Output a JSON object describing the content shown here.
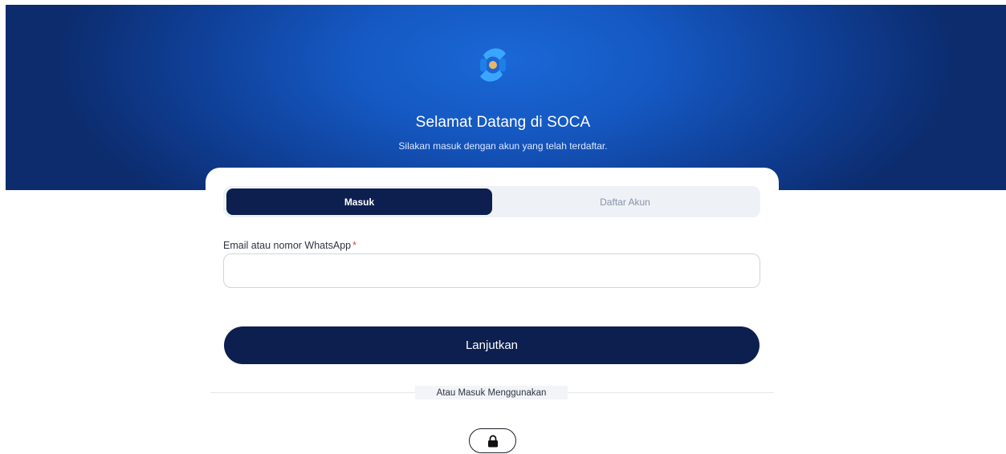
{
  "header": {
    "logo_icon": "soca-logo-icon",
    "title": "Selamat Datang di SOCA",
    "subtitle": "Silakan masuk dengan akun yang telah terdaftar."
  },
  "tabs": [
    {
      "label": "Masuk",
      "active": true
    },
    {
      "label": "Daftar Akun",
      "active": false
    }
  ],
  "form": {
    "email_label": "Email atau nomor WhatsApp",
    "required_mark": "*",
    "email_value": "",
    "email_placeholder": "",
    "submit_label": "Lanjutkan"
  },
  "alt_login": {
    "divider_text": "Atau Masuk Menggunakan",
    "sso_icon": "lock-icon"
  },
  "colors": {
    "brand_navy": "#0d1f4f",
    "hero_blue": "#1558c2",
    "required_red": "#e0434b"
  }
}
